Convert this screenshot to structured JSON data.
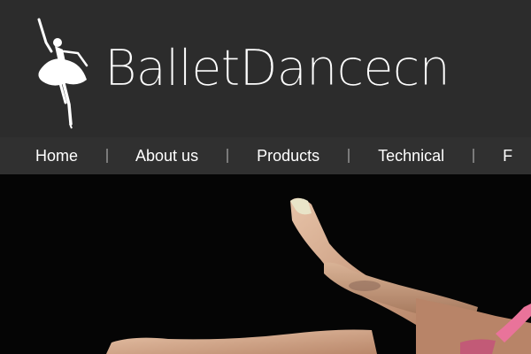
{
  "brand": {
    "name": "BalletDancecn",
    "logo_icon": "ballerina-silhouette-icon"
  },
  "nav": {
    "items": [
      {
        "label": "Home"
      },
      {
        "label": "About us"
      },
      {
        "label": "Products"
      },
      {
        "label": "Technical"
      },
      {
        "label": "F"
      }
    ]
  },
  "hero": {
    "image": "gymnast-legs-photo"
  },
  "colors": {
    "header_bg": "#2c2c2c",
    "nav_bg": "#303030",
    "text": "#ffffff",
    "separator": "#7a7a7a",
    "hero_bg": "#050505"
  }
}
